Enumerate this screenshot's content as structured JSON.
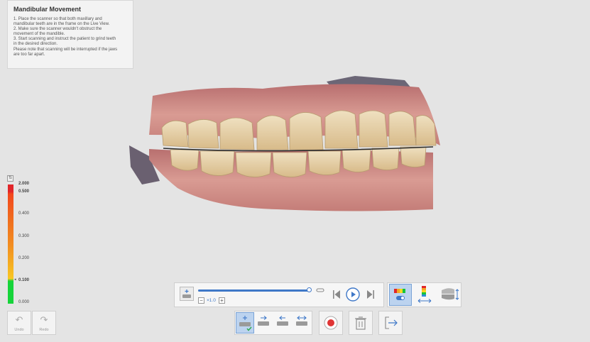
{
  "instructions": {
    "title": "Mandibular Movement",
    "lines": [
      "1. Place the scanner so that both maxillary and",
      "mandibular teeth are in the frame on the Live View.",
      "2. Make sure the scanner wouldn't obstruct the",
      "movement of the mandible.",
      "3. Start scanning and instruct the patient to grind teeth",
      "in the desired direction.",
      "Please note that scanning will be interrupted if the jaws",
      "are too far apart."
    ]
  },
  "legend": {
    "ticks": [
      "2.000",
      "0.500",
      "0.400",
      "0.300",
      "0.200",
      "0.100",
      "0.000"
    ],
    "marker": "◂"
  },
  "undo": {
    "label": "Undo"
  },
  "redo": {
    "label": "Redo"
  },
  "playback": {
    "progress": 1.0,
    "speed": "×1.0",
    "minus": "−",
    "plus": "+"
  },
  "colors": {
    "accent": "#3f78c8",
    "record": "#e03535",
    "selected_bg": "#bcd3ef"
  }
}
